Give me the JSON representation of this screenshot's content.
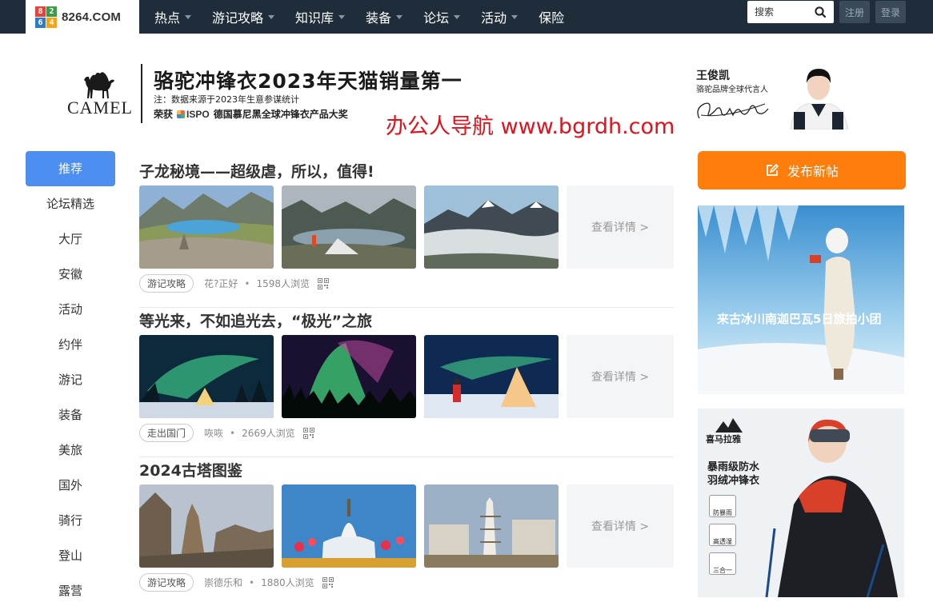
{
  "site": {
    "logo_digits": [
      "8",
      "2",
      "6",
      "4"
    ],
    "logo_text": "8264.COM"
  },
  "nav": {
    "items": [
      {
        "label": "热点",
        "dropdown": true
      },
      {
        "label": "游记攻略",
        "dropdown": true
      },
      {
        "label": "知识库",
        "dropdown": true
      },
      {
        "label": "装备",
        "dropdown": true
      },
      {
        "label": "论坛",
        "dropdown": true
      },
      {
        "label": "活动",
        "dropdown": true
      },
      {
        "label": "保险",
        "dropdown": false
      }
    ],
    "search_placeholder": "搜索",
    "register": "注册",
    "login": "登录"
  },
  "ad": {
    "brand": "CAMEL",
    "headline": "骆驼冲锋衣2023年天猫销量第一",
    "note": "注：数据来源于2023年生意参谋统计",
    "award_prefix": "荣获",
    "award_logo": "ISPO",
    "award_text": "德国慕尼黑全球冲锋衣产品大奖",
    "spokes_name": "王俊凯",
    "spokes_role": "骆驼品牌全球代言人"
  },
  "watermark": "办公人导航 www.bgrdh.com",
  "sidebar": {
    "items": [
      "推荐",
      "论坛精选",
      "大厅",
      "安徽",
      "活动",
      "约伴",
      "游记",
      "装备",
      "美旅",
      "国外",
      "骑行",
      "登山",
      "露营"
    ],
    "active_index": 0
  },
  "feed": {
    "more_label": "查看详情 >",
    "posts": [
      {
        "title": "子龙秘境——超级虐，所以，值得!",
        "tag": "游记攻略",
        "author": "花?正好",
        "views": "1598人浏览"
      },
      {
        "title": "等光来，不如追光去，“极光”之旅",
        "tag": "走出国门",
        "author": "咴咴",
        "views": "2669人浏览"
      },
      {
        "title": "2024古塔图鉴",
        "tag": "游记攻略",
        "author": "崇德乐和",
        "views": "1880人浏览"
      }
    ]
  },
  "right": {
    "new_post": "发布新帖",
    "promo1_title": "来古冰川南迦巴瓦5日旅拍小团",
    "promo2_brand": "喜马拉雅",
    "promo2_line1": "暴雨级防水",
    "promo2_line2": "羽绒冲锋衣",
    "promo2_badges": [
      "防暴雨",
      "高透湿",
      "三合一"
    ]
  },
  "colors": {
    "nav_bg": "#1f2d3a",
    "accent_blue": "#4d8ff0",
    "accent_orange": "#ff7d0a",
    "watermark_red": "#e4111c"
  }
}
